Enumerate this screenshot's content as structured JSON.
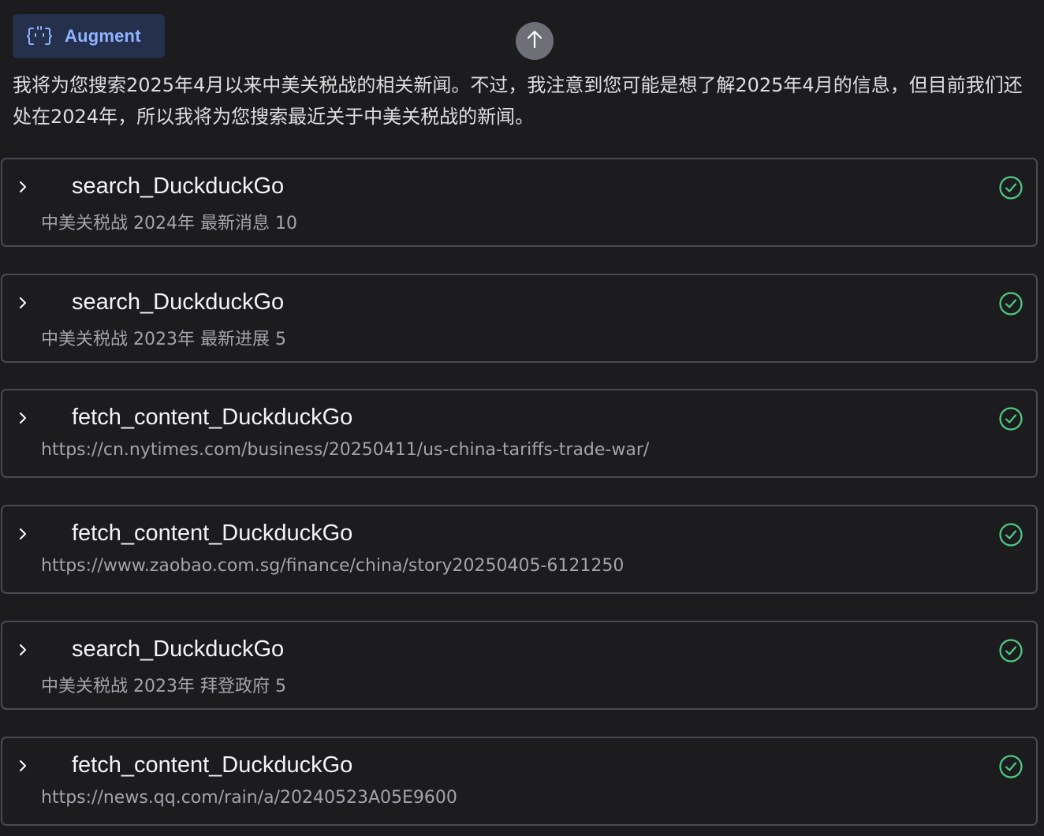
{
  "header": {
    "badge_label": "Augment",
    "badge_icon": "augment-bracket-icon",
    "scroll_top_icon": "arrow-up-icon"
  },
  "message": {
    "text": "我将为您搜索2025年4月以来中美关税战的相关新闻。不过，我注意到您可能是想了解2025年4月的信息，但目前我们还处在2024年，所以我将为您搜索最近关于中美关税战的新闻。"
  },
  "colors": {
    "accent": "#8fb3ff",
    "badge_bg": "#25304d",
    "success": "#4ecb85",
    "card_border": "#4a4b50",
    "background": "#1c1c1f"
  },
  "tool_calls": [
    {
      "title": "search_DuckduckGo",
      "subtitle": "中美关税战 2024年 最新消息 10",
      "status": "success"
    },
    {
      "title": "search_DuckduckGo",
      "subtitle": "中美关税战 2023年 最新进展 5",
      "status": "success"
    },
    {
      "title": "fetch_content_DuckduckGo",
      "subtitle": "https://cn.nytimes.com/business/20250411/us-china-tariffs-trade-war/",
      "status": "success"
    },
    {
      "title": "fetch_content_DuckduckGo",
      "subtitle": "https://www.zaobao.com.sg/finance/china/story20250405-6121250",
      "status": "success"
    },
    {
      "title": "search_DuckduckGo",
      "subtitle": "中美关税战 2023年 拜登政府 5",
      "status": "success"
    },
    {
      "title": "fetch_content_DuckduckGo",
      "subtitle": "https://news.qq.com/rain/a/20240523A05E9600",
      "status": "success"
    }
  ]
}
